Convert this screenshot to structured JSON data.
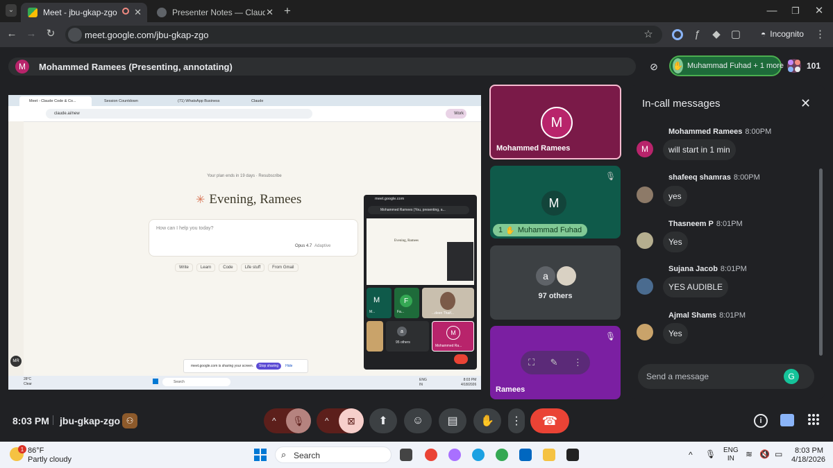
{
  "browser": {
    "tabs": [
      {
        "title": "Meet - jbu-gkap-zgo",
        "active": true
      },
      {
        "title": "Presenter Notes — Claude Code",
        "active": false
      }
    ],
    "new_tab": "+",
    "url": "meet.google.com/jbu-gkap-zgo",
    "profile": "Incognito"
  },
  "meet": {
    "presenter_banner": "Mohammed Ramees (Presenting, annotating)",
    "presenter_initial": "M",
    "raised_hand": "Muhammad Fuhad + 1 more",
    "participants_count": "101",
    "meeting_time": "8:03 PM",
    "meeting_code": "jbu-gkap-zgo"
  },
  "shared_screen": {
    "tabs": [
      "Meet - Claude Code & Co...",
      "Session Countdown",
      "(71) WhatsApp Business",
      "Claude"
    ],
    "url": "claude.ai/new",
    "profile": "Work",
    "plan_notice": "Your plan ends in 19 days · Resubscribe",
    "greeting": "Evening, Ramees",
    "prompt_placeholder": "How can I help you today?",
    "model": "Opus 4.7",
    "model_mode": "Adaptive",
    "actions": [
      "Write",
      "Learn",
      "Code",
      "Life stuff",
      "From Gmail"
    ],
    "sharing_notice": "meet.google.com is sharing your screen.",
    "stop_sharing": "Stop sharing",
    "hide": "Hide",
    "user_initials": "MR",
    "weather_temp": "28°C",
    "weather_desc": "Clear",
    "search": "Search",
    "lang": "ENG",
    "region": "IN",
    "clock_time": "8:03 PM",
    "clock_date": "4/18/2026",
    "mini_meet": {
      "url": "meet.google.com",
      "banner": "Mohammed Ramees (You, presenting, a...",
      "greeting": "Evening, Ramees",
      "others": "95 others",
      "tile_names": [
        "M...",
        "Fa...",
        "...deen Thaif...",
        "Mohammed Ra..."
      ],
      "initials": [
        "M",
        "F",
        "a",
        "M"
      ]
    }
  },
  "tiles": [
    {
      "name": "Mohammed Ramees",
      "initial": "M"
    },
    {
      "name": "Muhammad Fuhad",
      "initial": "M",
      "hand_count": "1"
    },
    {
      "name": "97 others",
      "initial": "a"
    },
    {
      "name": "Ramees"
    }
  ],
  "chat": {
    "title": "In-call messages",
    "input_placeholder": "Send a message",
    "messages": [
      {
        "sender": "Mohammed Ramees",
        "time": "8:00PM",
        "text": "will start in 1 min",
        "initial": "M"
      },
      {
        "sender": "shafeeq shamras",
        "time": "8:00PM",
        "text": "yes"
      },
      {
        "sender": "Thasneem P",
        "time": "8:01PM",
        "text": "Yes"
      },
      {
        "sender": "Sujana Jacob",
        "time": "8:01PM",
        "text": "YES AUDIBLE"
      },
      {
        "sender": "Ajmal Shams",
        "time": "8:01PM",
        "text": "Yes"
      }
    ]
  },
  "taskbar": {
    "temp": "86°F",
    "weather": "Partly cloudy",
    "badge": "1",
    "search": "Search",
    "lang": "ENG",
    "region": "IN",
    "time": "8:03 PM",
    "date": "4/18/2026"
  },
  "colors": {
    "presenter_tile": "#b8246b",
    "fuhad_tile": "#0f5a4a",
    "ramees_tile": "#7b1fa2",
    "end_call": "#ea4335",
    "raise_hand_pill": "#4caf50"
  }
}
